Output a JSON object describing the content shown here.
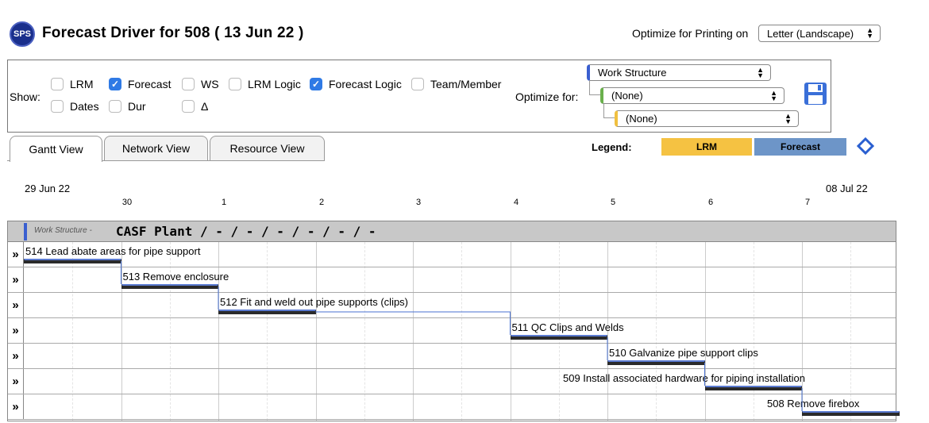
{
  "header": {
    "logo": "SPS",
    "title": "Forecast Driver for 508 ( 13 Jun 22 )",
    "print_label": "Optimize for Printing on",
    "print_option": "Letter (Landscape)"
  },
  "options": {
    "show_label": "Show:",
    "checkboxes": [
      {
        "label": "LRM",
        "checked": false
      },
      {
        "label": "Forecast",
        "checked": true
      },
      {
        "label": "WS",
        "checked": false
      },
      {
        "label": "LRM Logic",
        "checked": false
      },
      {
        "label": "Forecast Logic",
        "checked": true
      },
      {
        "label": "Team/Member",
        "checked": false
      },
      {
        "label": "Dates",
        "checked": false
      },
      {
        "label": "Dur",
        "checked": false
      },
      {
        "label": "Δ",
        "checked": false
      }
    ],
    "optimize_label": "Optimize for:",
    "optimize_selects": [
      "Work Structure",
      "(None)",
      "(None)"
    ]
  },
  "tabs": [
    {
      "label": "Gantt View",
      "active": true
    },
    {
      "label": "Network View",
      "active": false
    },
    {
      "label": "Resource View",
      "active": false
    }
  ],
  "legend": {
    "label": "Legend:",
    "items": [
      {
        "label": "LRM",
        "color": "#f5c242"
      },
      {
        "label": "Forecast",
        "color": "#6d95c8"
      }
    ]
  },
  "axis": {
    "start": "29 Jun 22",
    "end": "08 Jul 22",
    "ticks": [
      "30",
      "1",
      "2",
      "3",
      "4",
      "5",
      "6",
      "7"
    ]
  },
  "gantt": {
    "ws_label": "Work Structure -",
    "ws_name": "CASF Plant / - / - / - / - / - / -",
    "expander": "»",
    "tasks": [
      {
        "label": "514 Lead abate areas for pipe support",
        "start": 0,
        "end": 1
      },
      {
        "label": "513 Remove enclosure",
        "start": 1,
        "end": 2
      },
      {
        "label": "512 Fit and weld out pipe supports (clips)",
        "start": 2,
        "end": 3
      },
      {
        "label": "511 QC Clips and Welds",
        "start": 5,
        "end": 6
      },
      {
        "label": "510 Galvanize pipe support clips",
        "start": 6,
        "end": 7
      },
      {
        "label": "509 Install associated hardware for piping installation",
        "start": 7,
        "end": 8
      },
      {
        "label": "508 Remove firebox",
        "start": 8,
        "end": 9
      }
    ]
  }
}
